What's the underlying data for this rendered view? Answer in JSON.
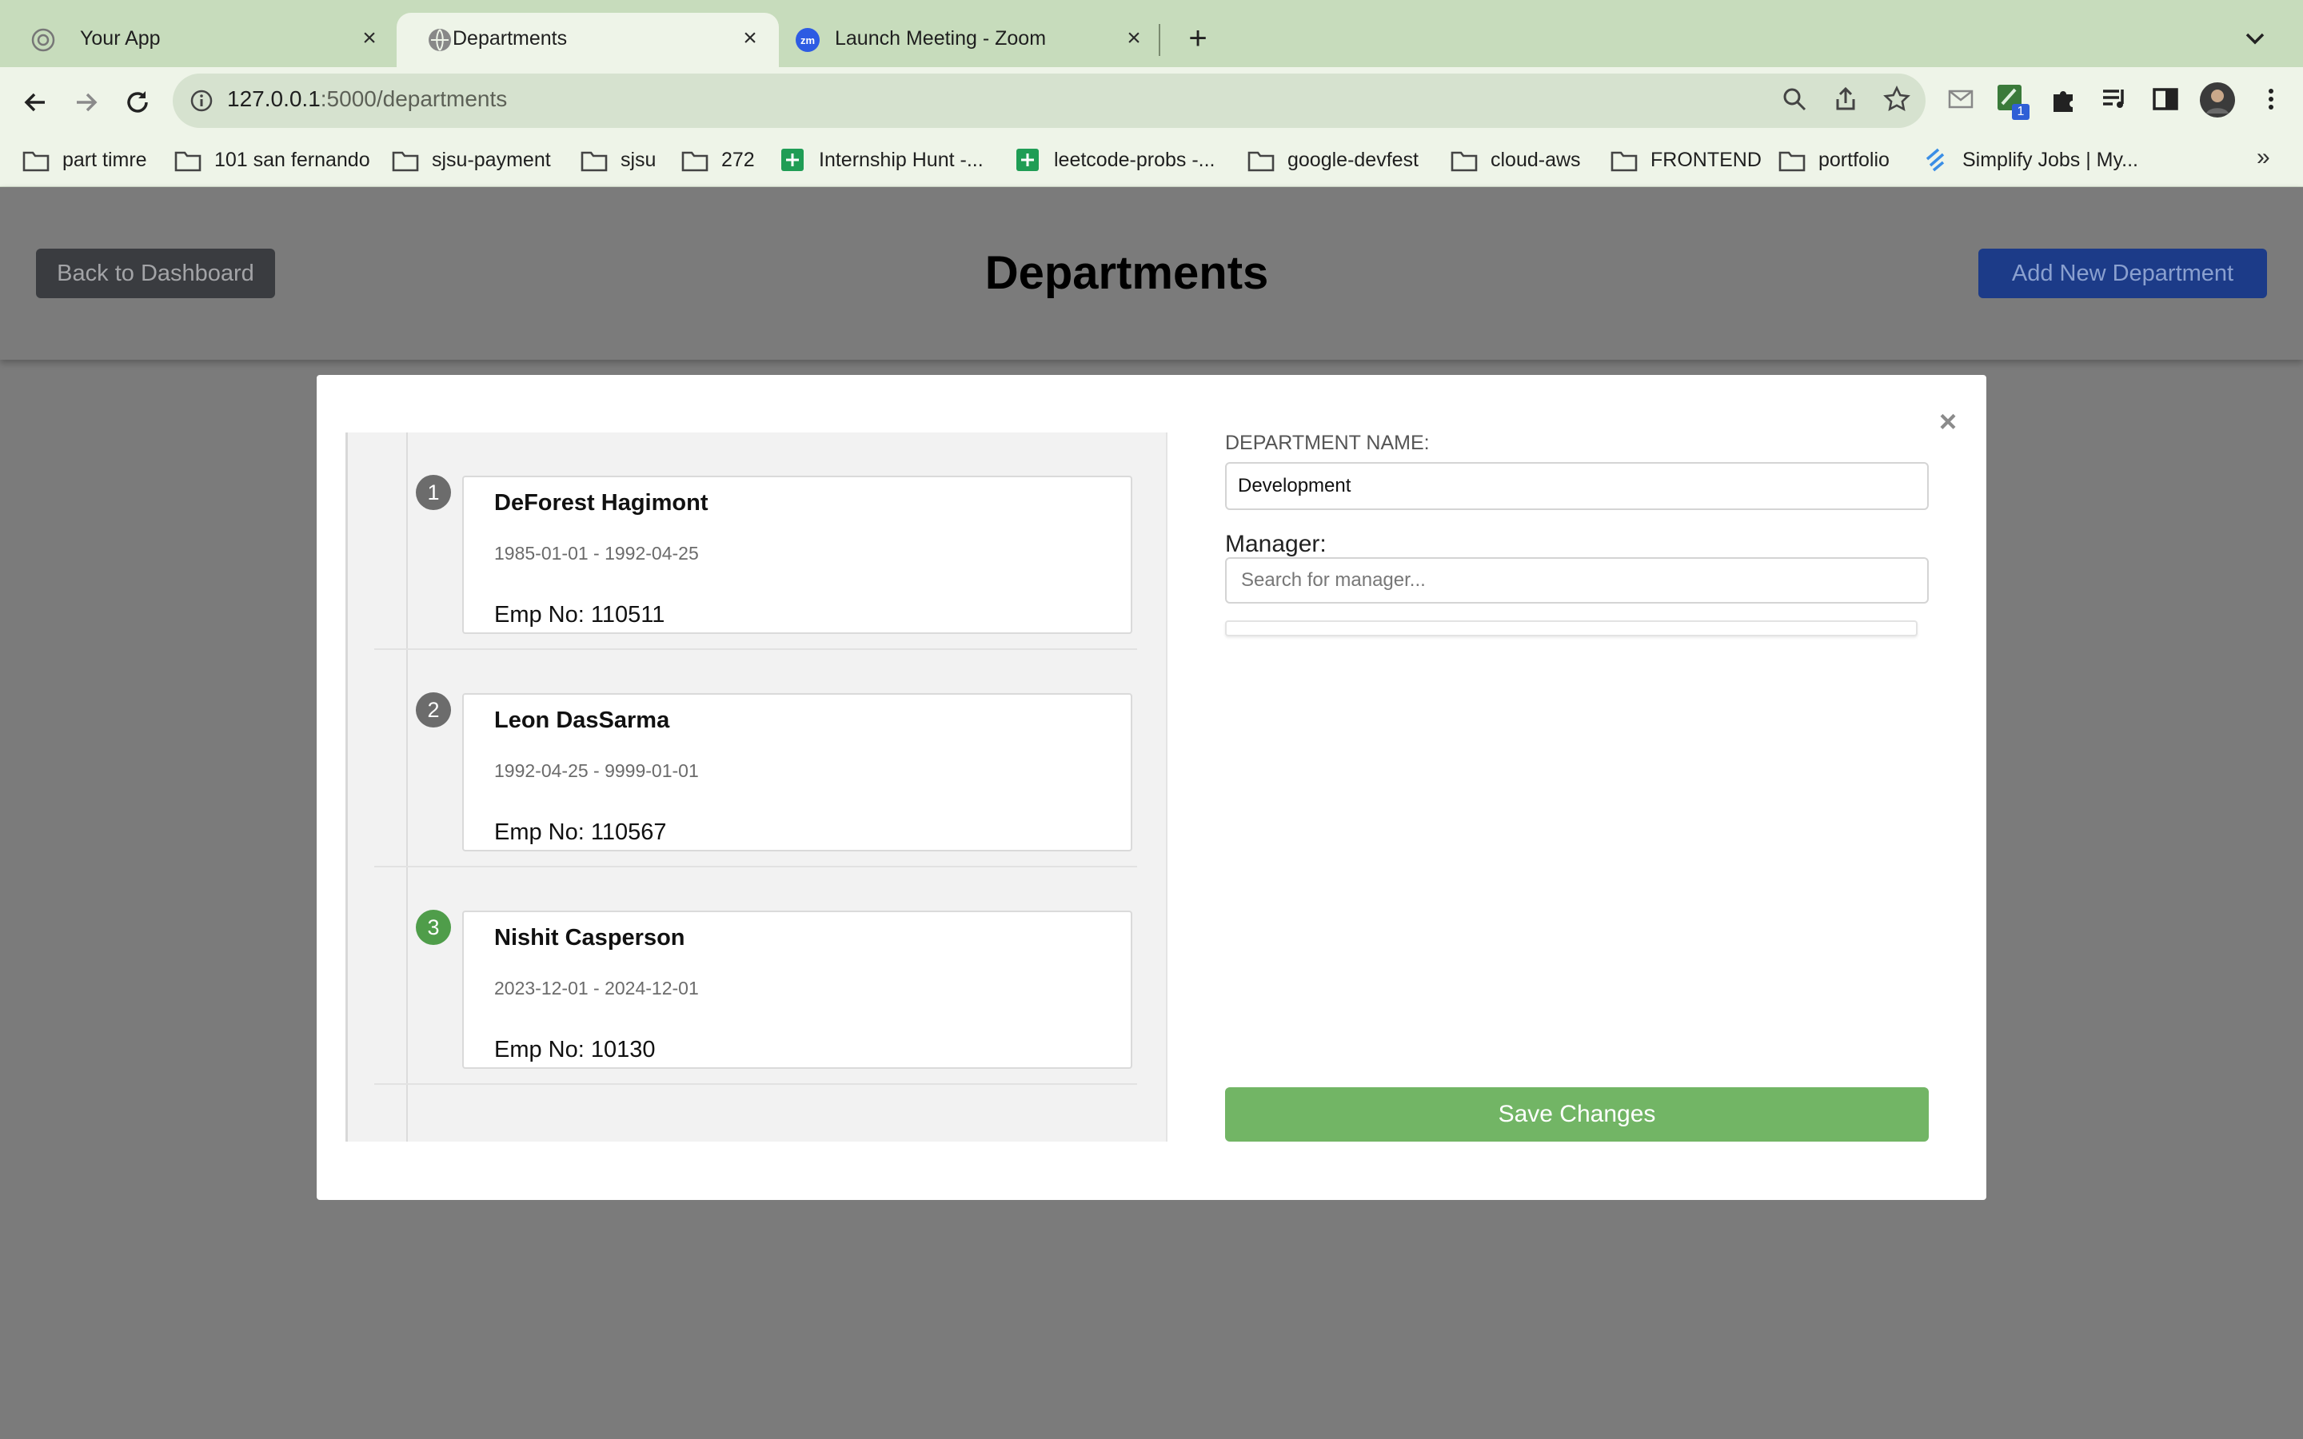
{
  "browser": {
    "tabs": [
      {
        "title": "Your App",
        "icon": "globe-icon",
        "active": false
      },
      {
        "title": "Departments",
        "icon": "globe-icon",
        "active": true
      },
      {
        "title": "Launch Meeting - Zoom",
        "icon": "zoom-icon",
        "active": false
      }
    ],
    "url_host": "127.0.0.1",
    "url_path": ":5000/departments",
    "extension_badge": "1",
    "bookmarks": [
      {
        "label": "part timre",
        "icon": "folder-icon"
      },
      {
        "label": "101 san fernando",
        "icon": "folder-icon"
      },
      {
        "label": "sjsu-payment",
        "icon": "folder-icon"
      },
      {
        "label": "sjsu",
        "icon": "folder-icon"
      },
      {
        "label": "272",
        "icon": "folder-icon"
      },
      {
        "label": "Internship Hunt -...",
        "icon": "sheets-icon"
      },
      {
        "label": "leetcode-probs -...",
        "icon": "sheets-icon"
      },
      {
        "label": "google-devfest",
        "icon": "folder-icon"
      },
      {
        "label": "cloud-aws",
        "icon": "folder-icon"
      },
      {
        "label": "FRONTEND",
        "icon": "folder-icon"
      },
      {
        "label": "portfolio",
        "icon": "folder-icon"
      },
      {
        "label": "Simplify Jobs | My...",
        "icon": "simplify-icon"
      }
    ],
    "bookmarks_more": "»"
  },
  "header": {
    "back_label": "Back to Dashboard",
    "title": "Departments",
    "add_label": "Add New Department"
  },
  "modal": {
    "close_glyph": "×",
    "timeline": [
      {
        "step": "1",
        "name": "DeForest Hagimont",
        "dates": "1985-01-01 - 1992-04-25",
        "emp": "Emp No: 110511",
        "color": "#6c6c6c"
      },
      {
        "step": "2",
        "name": "Leon DasSarma",
        "dates": "1992-04-25 - 9999-01-01",
        "emp": "Emp No: 110567",
        "color": "#6c6c6c"
      },
      {
        "step": "3",
        "name": "Nishit Casperson",
        "dates": "2023-12-01 - 2024-12-01",
        "emp": "Emp No: 10130",
        "color": "#4f9d4a"
      }
    ],
    "dept_label": "DEPARTMENT NAME:",
    "dept_value": "Development",
    "manager_label": "Manager:",
    "manager_placeholder": "Search for manager...",
    "save_label": "Save Changes"
  },
  "colors": {
    "overlay": "#7b7b7b",
    "save": "#72b565",
    "add": "#1c3b88",
    "back": "#3a3c40"
  }
}
